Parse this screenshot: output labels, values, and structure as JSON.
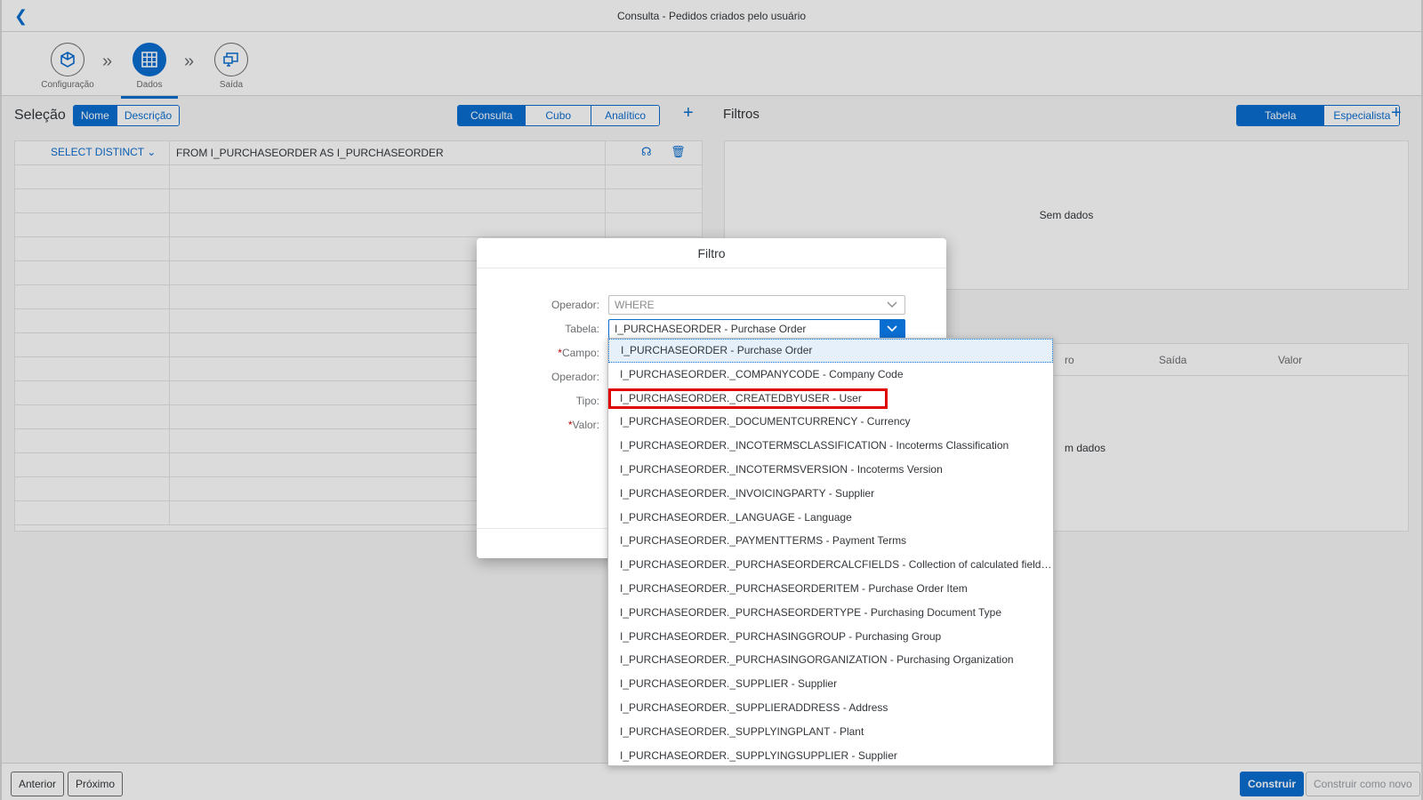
{
  "shell": {
    "title": "Consulta - Pedidos criados pelo usuário"
  },
  "wizard": {
    "steps": [
      {
        "label": "Configuração",
        "icon": "cube-icon"
      },
      {
        "label": "Dados",
        "icon": "grid-icon"
      },
      {
        "label": "Saída",
        "icon": "monitor-icon"
      }
    ]
  },
  "selecao": {
    "heading": "Seleção",
    "toggle": [
      "Nome",
      "Descrição"
    ],
    "tabs": [
      "Consulta",
      "Cubo",
      "Analítico"
    ],
    "row1": {
      "select": "SELECT DISTINCT",
      "from": "FROM I_PURCHASEORDER AS I_PURCHASEORDER"
    }
  },
  "filtros": {
    "heading": "Filtros",
    "toggle": [
      "Tabela",
      "Especialista"
    ],
    "nodata": "Sem dados",
    "columns": [
      "Saída",
      "Valor"
    ],
    "partial_col": "ro",
    "nodata2": "m dados"
  },
  "dialog": {
    "title": "Filtro",
    "labels": {
      "operador": "Operador:",
      "tabela": "Tabela:",
      "campo": "Campo:",
      "operador2": "Operador:",
      "tipo": "Tipo:",
      "valor": "Valor:"
    },
    "operador_value": "WHERE",
    "tabela_value": "I_PURCHASEORDER - Purchase Order"
  },
  "dropdown_items": [
    "I_PURCHASEORDER - Purchase Order",
    "I_PURCHASEORDER._COMPANYCODE - Company Code",
    "I_PURCHASEORDER._CREATEDBYUSER - User",
    "I_PURCHASEORDER._DOCUMENTCURRENCY - Currency",
    "I_PURCHASEORDER._INCOTERMSCLASSIFICATION - Incoterms Classification",
    "I_PURCHASEORDER._INCOTERMSVERSION - Incoterms Version",
    "I_PURCHASEORDER._INVOICINGPARTY - Supplier",
    "I_PURCHASEORDER._LANGUAGE - Language",
    "I_PURCHASEORDER._PAYMENTTERMS - Payment Terms",
    "I_PURCHASEORDER._PURCHASEORDERCALCFIELDS - Collection of calculated fields o...",
    "I_PURCHASEORDER._PURCHASEORDERITEM - Purchase Order Item",
    "I_PURCHASEORDER._PURCHASEORDERTYPE - Purchasing Document Type",
    "I_PURCHASEORDER._PURCHASINGGROUP - Purchasing Group",
    "I_PURCHASEORDER._PURCHASINGORGANIZATION - Purchasing Organization",
    "I_PURCHASEORDER._SUPPLIER - Supplier",
    "I_PURCHASEORDER._SUPPLIERADDRESS - Address",
    "I_PURCHASEORDER._SUPPLYINGPLANT - Plant",
    "I_PURCHASEORDER._SUPPLYINGSUPPLIER - Supplier"
  ],
  "footer": {
    "anterior": "Anterior",
    "proximo": "Próximo",
    "construir": "Construir",
    "construir_novo": "Construir como novo"
  },
  "colors": {
    "accent": "#0a6ed1",
    "highlight": "#e00000"
  }
}
